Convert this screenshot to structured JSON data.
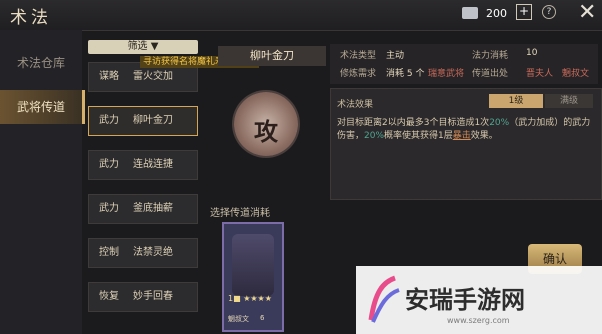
{
  "header": {
    "title": "术法",
    "currency_value": "200",
    "plus": "+",
    "help": "?",
    "close": "✕"
  },
  "left_nav": [
    {
      "label": "术法仓库"
    },
    {
      "label": "武将传道"
    }
  ],
  "filter": {
    "label": "筛选 ▼"
  },
  "skills": [
    {
      "type": "谋略",
      "name": "雷火交加",
      "selected": false
    },
    {
      "type": "武力",
      "name": "柳叶金刀",
      "selected": true
    },
    {
      "type": "武力",
      "name": "连战连捷",
      "selected": false
    },
    {
      "type": "武力",
      "name": "釜底抽薪",
      "selected": false
    },
    {
      "type": "控制",
      "name": "法禁灵绝",
      "selected": false
    },
    {
      "type": "恢复",
      "name": "妙手回春",
      "selected": false
    }
  ],
  "tooltip": "寻访获得名将魔礼寿!",
  "detail": {
    "name": "柳叶金刀",
    "emblem": "攻",
    "rows": [
      {
        "label": "术法类型",
        "value": "主动",
        "label2": "法力消耗",
        "value2": "10"
      },
      {
        "label": "修炼需求",
        "value": "消耗 5 个",
        "extra": "瑞意武将",
        "label2": "传道出处",
        "value2": "晋夫人",
        "value3": "魍叔文"
      }
    ],
    "effect_label": "术法效果",
    "level_tabs": [
      "1级",
      "满级"
    ],
    "effect_text": {
      "p1": "对目标距离2以内最多3个目标造成1次",
      "pct1": "20%",
      "p2": "（武力加成）的武力伤害，",
      "pct2": "20%",
      "p3": "概率使其获得1层",
      "link": "暴击",
      "p4": "效果。"
    }
  },
  "choose_label": "选择传道消耗",
  "hero": {
    "level": "1■",
    "stars": "★★★★",
    "name": "魍叔文",
    "count": "6"
  },
  "confirm": "确认",
  "watermark": {
    "text": "安瑞手游网",
    "url": "www.szerg.com"
  }
}
